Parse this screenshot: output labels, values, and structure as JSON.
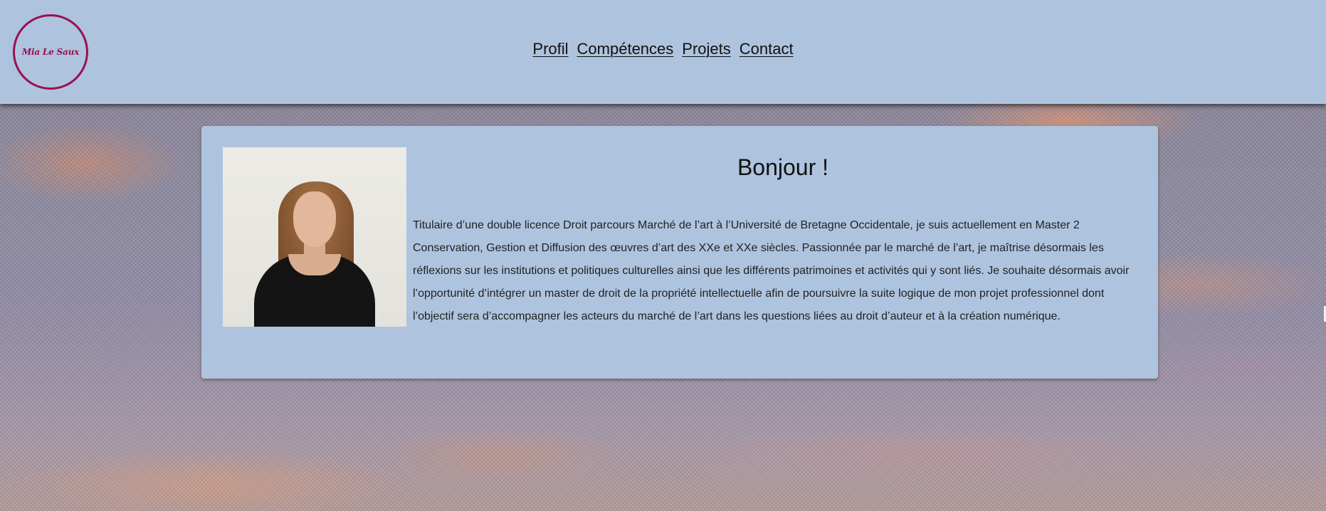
{
  "header": {
    "logo_text": "Mia Le Saux",
    "nav": {
      "profil": "Profil",
      "competences": "Compétences",
      "projets": "Projets",
      "contact": "Contact"
    }
  },
  "main": {
    "greeting": "Bonjour !",
    "bio": "Titulaire d’une double licence Droit parcours Marché de l’art à l’Université de Bretagne Occidentale, je suis actuellement en Master 2 Conservation, Gestion et Diffusion des œuvres d’art des XXe et XXe siècles. Passionnée par le marché de l’art, je maîtrise désormais les réflexions sur les institutions et politiques culturelles ainsi que les différents patrimoines et activités qui y sont liés. Je souhaite désormais avoir l’opportunité d’intégrer un master de droit de la propriété intellectuelle afin de poursuivre la suite logique de mon projet professionnel dont l’objectif sera d’accompagner les acteurs du marché de l’art dans les questions liées au droit d’auteur et à la création numérique."
  },
  "colors": {
    "header_bg": "#aec3de",
    "card_bg": "#aec3de",
    "logo_accent": "#9a1050"
  }
}
